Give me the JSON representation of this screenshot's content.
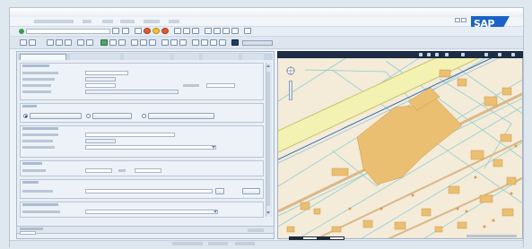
{
  "sap_logo": "SAP",
  "colors": {
    "sap_blue": "#1b63c6",
    "map_bg": "#f3ead8",
    "map_building": "#e9b45d",
    "map_road_yellow": "#f4f0a8",
    "map_parcel_line": "#8ecfcf"
  },
  "icons": {
    "toolbar": [
      "back-icon",
      "exit-icon",
      "cancel-icon",
      "save-icon",
      "print-icon",
      "find-icon",
      "help-icon",
      "settings-icon"
    ]
  }
}
